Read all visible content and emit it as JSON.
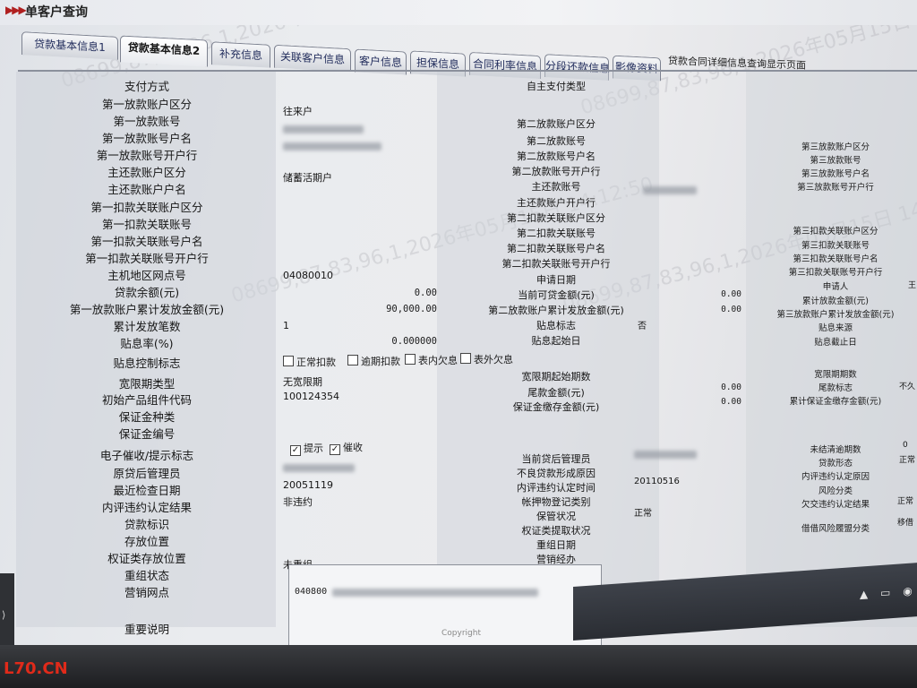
{
  "window": {
    "title": "单客户查询"
  },
  "tabs": [
    "贷款基本信息1",
    "贷款基本信息2",
    "补充信息",
    "关联客户信息",
    "客户信息",
    "担保信息",
    "合同利率信息",
    "分段还款信息",
    "影像资料"
  ],
  "tab_extra": "贷款合同详细信息查询显示页面",
  "col1": [
    {
      "label": "支付方式",
      "value": ""
    },
    {
      "label": "第一放款账户区分",
      "value": "往来户"
    },
    {
      "label": "第一放款账号",
      "value": ""
    },
    {
      "label": "第一放款账号户名",
      "value": ""
    },
    {
      "label": "第一放款账号开户行",
      "value": ""
    },
    {
      "label": "主还款账户区分",
      "value": "储蓄活期户"
    },
    {
      "label": "主还款账户户名",
      "value": ""
    },
    {
      "label": "第一扣款关联账户区分",
      "value": ""
    },
    {
      "label": "第一扣款关联账号",
      "value": ""
    },
    {
      "label": "第一扣款关联账号户名",
      "value": ""
    },
    {
      "label": "第一扣款关联账号开户行",
      "value": ""
    },
    {
      "label": "主机地区网点号",
      "value": "04080010"
    },
    {
      "label": "贷款余额(元)",
      "value": "0.00"
    },
    {
      "label": "第一放款账户累计发放金额(元)",
      "value": "90,000.00"
    },
    {
      "label": "累计发放笔数",
      "value": "1"
    },
    {
      "label": "贴息率(%)",
      "value": "0.000000"
    },
    {
      "label": "贴息控制标志",
      "value": ""
    },
    {
      "label": "宽限期类型",
      "value": "无宽限期"
    },
    {
      "label": "初始产品组件代码",
      "value": "100124354"
    },
    {
      "label": "保证金种类",
      "value": ""
    },
    {
      "label": "保证金编号",
      "value": ""
    },
    {
      "label": "电子催收/提示标志",
      "value": ""
    },
    {
      "label": "原贷后管理员",
      "value": ""
    },
    {
      "label": "最近检查日期",
      "value": "20051119"
    },
    {
      "label": "内评违约认定结果",
      "value": "非违约"
    },
    {
      "label": "贷款标识",
      "value": ""
    },
    {
      "label": "存放位置",
      "value": ""
    },
    {
      "label": "权证类存放位置",
      "value": ""
    },
    {
      "label": "重组状态",
      "value": "未重组"
    },
    {
      "label": "营销网点",
      "value": ""
    },
    {
      "label": "重要说明",
      "value": ""
    }
  ],
  "col2": [
    {
      "label": "自主支付类型",
      "value": ""
    },
    {
      "label": "第二放款账户区分",
      "value": ""
    },
    {
      "label": "第二放款账号",
      "value": ""
    },
    {
      "label": "第二放款账号户名",
      "value": ""
    },
    {
      "label": "第二放款账号开户行",
      "value": ""
    },
    {
      "label": "主还款账号",
      "value": ""
    },
    {
      "label": "主还款账户开户行",
      "value": ""
    },
    {
      "label": "第二扣款关联账户区分",
      "value": ""
    },
    {
      "label": "第二扣款关联账号",
      "value": ""
    },
    {
      "label": "第二扣款关联账号户名",
      "value": ""
    },
    {
      "label": "第二扣款关联账号开户行",
      "value": ""
    },
    {
      "label": "申请日期",
      "value": ""
    },
    {
      "label": "当前可贷金额(元)",
      "value": "0.00"
    },
    {
      "label": "第二放款账户累计发放金额(元)",
      "value": "0.00"
    },
    {
      "label": "贴息标志",
      "value": "否"
    },
    {
      "label": "贴息起始日",
      "value": ""
    },
    {
      "label": "宽限期起始期数",
      "value": ""
    },
    {
      "label": "尾款金额(元)",
      "value": "0.00"
    },
    {
      "label": "保证金缴存金额(元)",
      "value": "0.00"
    },
    {
      "label": "当前贷后管理员",
      "value": ""
    },
    {
      "label": "不良贷款形成原因",
      "value": ""
    },
    {
      "label": "内评违约认定时间",
      "value": "20110516"
    },
    {
      "label": "帐押物登记类别",
      "value": ""
    },
    {
      "label": "保管状况",
      "value": "正常"
    },
    {
      "label": "权证类提取状况",
      "value": ""
    },
    {
      "label": "重组日期",
      "value": ""
    },
    {
      "label": "营销经办",
      "value": ""
    }
  ],
  "col3": [
    {
      "label": "第三放款账户区分",
      "value": ""
    },
    {
      "label": "第三放款账号",
      "value": ""
    },
    {
      "label": "第三放款账号户名",
      "value": ""
    },
    {
      "label": "第三放款账号开户行",
      "value": ""
    },
    {
      "label": "第三扣款关联账户区分",
      "value": ""
    },
    {
      "label": "第三扣款关联账号",
      "value": ""
    },
    {
      "label": "第三扣款关联账号户名",
      "value": ""
    },
    {
      "label": "第三扣款关联账号开户行",
      "value": ""
    },
    {
      "label": "申请人",
      "value": "王"
    },
    {
      "label": "累计放款金额(元)",
      "value": ""
    },
    {
      "label": "第三放款账户累计发放金额(元)",
      "value": ""
    },
    {
      "label": "贴息来源",
      "value": ""
    },
    {
      "label": "贴息截止日",
      "value": ""
    },
    {
      "label": "宽限期期数",
      "value": ""
    },
    {
      "label": "尾款标志",
      "value": "不久"
    },
    {
      "label": "累计保证金缴存金额(元)",
      "value": ""
    },
    {
      "label": "未结清逾期数",
      "value": "0"
    },
    {
      "label": "贷款形态",
      "value": "正常"
    },
    {
      "label": "内评违约认定原因",
      "value": ""
    },
    {
      "label": "风险分类",
      "value": ""
    },
    {
      "label": "欠交违约认定结果",
      "value": "正常"
    },
    {
      "label": "借借风险履盟分类",
      "value": "移借"
    }
  ],
  "checkboxes": {
    "discount_control": [
      {
        "label": "正常扣款",
        "checked": false
      },
      {
        "label": "逾期扣款",
        "checked": false
      },
      {
        "label": "表内欠息",
        "checked": false
      },
      {
        "label": "表外欠息",
        "checked": false
      }
    ],
    "electronic_notice": [
      {
        "label": "提示",
        "checked": true
      },
      {
        "label": "催收",
        "checked": true
      }
    ]
  },
  "note_text": "040800",
  "footer": {
    "copyright": "Copyright"
  },
  "watermark": "L70.CN",
  "screen_watermark": "08699,87,83,96,1,2026年05月15日 14:12:50",
  "icons": {
    "title": "triple-arrow-icon",
    "checkbox": "check-icon"
  }
}
